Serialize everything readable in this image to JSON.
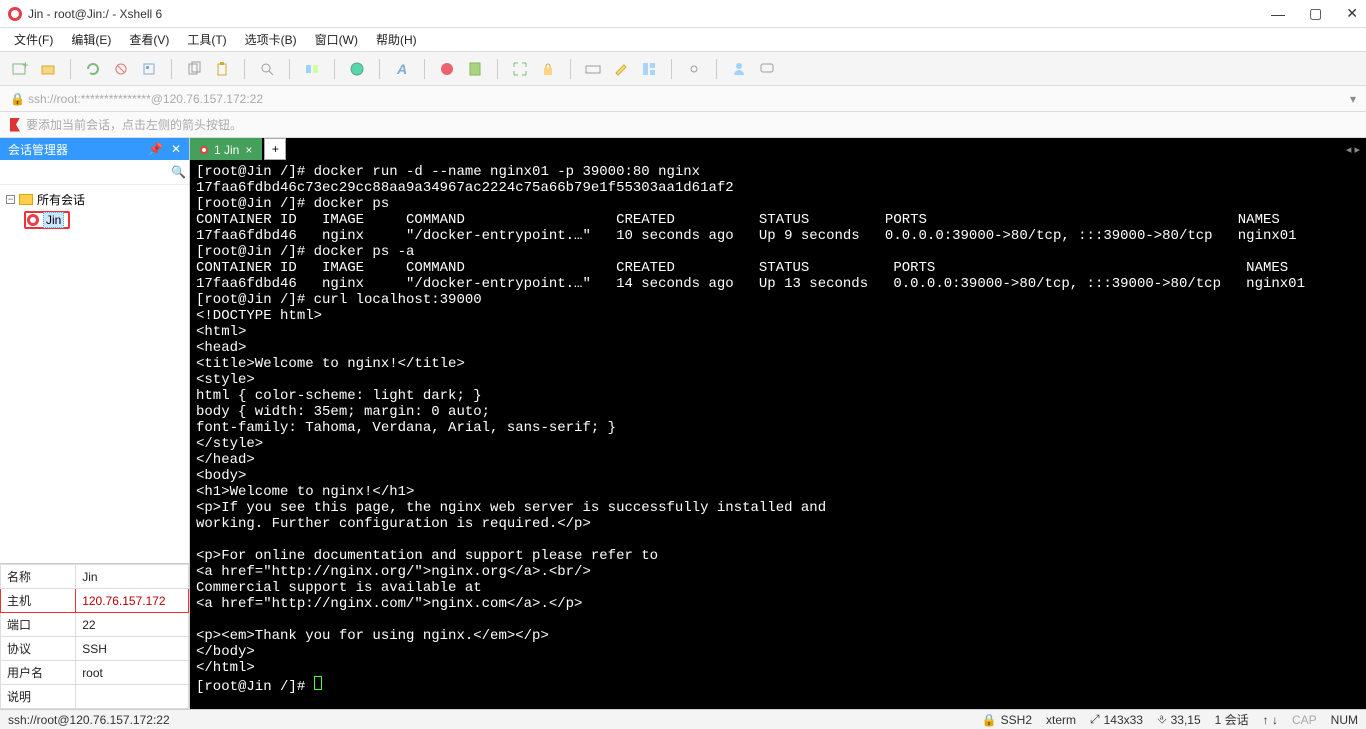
{
  "title": "Jin - root@Jin:/ - Xshell 6",
  "menu": [
    "文件(F)",
    "编辑(E)",
    "查看(V)",
    "工具(T)",
    "选项卡(B)",
    "窗口(W)",
    "帮助(H)"
  ],
  "address": "ssh://root:***************@120.76.157.172:22",
  "hint": "要添加当前会话，点击左侧的箭头按钮。",
  "sidebar": {
    "title": "会话管理器",
    "all_sessions": "所有会话",
    "session_name": "Jin"
  },
  "props": {
    "name_k": "名称",
    "name_v": "Jin",
    "host_k": "主机",
    "host_v": "120.76.157.172",
    "port_k": "端口",
    "port_v": "22",
    "proto_k": "协议",
    "proto_v": "SSH",
    "user_k": "用户名",
    "user_v": "root",
    "desc_k": "说明",
    "desc_v": ""
  },
  "tab": {
    "label": "1 Jin"
  },
  "terminal_lines": [
    "[root@Jin /]# docker run -d --name nginx01 -p 39000:80 nginx",
    "17faa6fdbd46c73ec29cc88aa9a34967ac2224c75a66b79e1f55303aa1d61af2",
    "[root@Jin /]# docker ps",
    "CONTAINER ID   IMAGE     COMMAND                  CREATED          STATUS         PORTS                                     NAMES",
    "17faa6fdbd46   nginx     \"/docker-entrypoint.…\"   10 seconds ago   Up 9 seconds   0.0.0.0:39000->80/tcp, :::39000->80/tcp   nginx01",
    "[root@Jin /]# docker ps -a",
    "CONTAINER ID   IMAGE     COMMAND                  CREATED          STATUS          PORTS                                     NAMES",
    "17faa6fdbd46   nginx     \"/docker-entrypoint.…\"   14 seconds ago   Up 13 seconds   0.0.0.0:39000->80/tcp, :::39000->80/tcp   nginx01",
    "[root@Jin /]# curl localhost:39000",
    "<!DOCTYPE html>",
    "<html>",
    "<head>",
    "<title>Welcome to nginx!</title>",
    "<style>",
    "html { color-scheme: light dark; }",
    "body { width: 35em; margin: 0 auto;",
    "font-family: Tahoma, Verdana, Arial, sans-serif; }",
    "</style>",
    "</head>",
    "<body>",
    "<h1>Welcome to nginx!</h1>",
    "<p>If you see this page, the nginx web server is successfully installed and",
    "working. Further configuration is required.</p>",
    "",
    "<p>For online documentation and support please refer to",
    "<a href=\"http://nginx.org/\">nginx.org</a>.<br/>",
    "Commercial support is available at",
    "<a href=\"http://nginx.com/\">nginx.com</a>.</p>",
    "",
    "<p><em>Thank you for using nginx.</em></p>",
    "</body>",
    "</html>",
    "[root@Jin /]# "
  ],
  "status": {
    "left": "ssh://root@120.76.157.172:22",
    "ssh": "SSH2",
    "term": "xterm",
    "size": "143x33",
    "pos": "33,15",
    "sessions": "1 会话",
    "updown": "↑  ↓",
    "cap": "CAP",
    "num": "NUM"
  }
}
